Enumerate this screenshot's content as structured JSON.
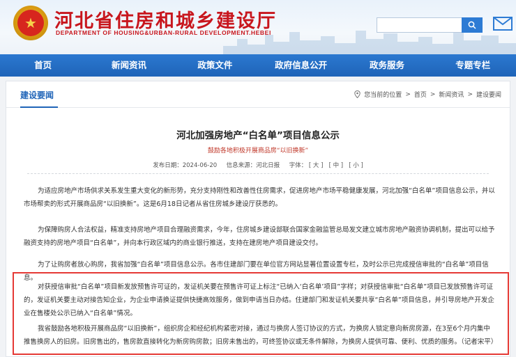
{
  "header": {
    "title": "河北省住房和城乡建设厅",
    "subtitle": "DEPARTMENT OF HOUSING&URBAN-RURAL DEVELOPMENT.HEBEI",
    "search_placeholder": ""
  },
  "nav": {
    "items": [
      "首页",
      "新闻资讯",
      "政策文件",
      "政府信息公开",
      "政务服务",
      "专题专栏"
    ]
  },
  "section": {
    "title": "建设要闻",
    "breadcrumb": {
      "prefix": "您当前的位置",
      "items": [
        "首页",
        "新闻资讯",
        "建设要闻"
      ],
      "separator": ">"
    }
  },
  "article": {
    "title": "河北加强房地产“白名单”项目信息公示",
    "subtitle": "鼓励各地积极开展商品房“以旧换新”",
    "meta": {
      "date_label": "发布日期：2024-06-20",
      "views_label": "信息来源：河北日报",
      "font_label": "字体：",
      "font_large": "[ 大 ]",
      "font_medium": "[ 中 ]",
      "font_small": "[ 小 ]"
    },
    "paragraphs": [
      "为适应房地产市场供求关系发生重大变化的新形势，充分支持刚性和改善性住房需求，促进房地产市场平稳健康发展，河北加强“白名单”项目信息公示，并以市场帮卖的形式开展商品房“以旧换新”。这是6月18日记者从省住房城乡建设厅获悉的。",
      "为保障购房人合法权益，精准支持房地产项目合理融资需求，今年，住房城乡建设部联合国家金融监管总局发文建立城市房地产融资协调机制，提出可以给予融资支持的房地产项目“白名单”，并向本行政区域内的商业银行推送，支持在建房地产项目建设交付。",
      "为了让购房者放心购房，我省加强“白名单”项目信息公示。各市住建部门要在单位官方网站显著位置设置专栏，及时公示已完成授信审批的“白名单”项目信息。",
      "对获授信审批“白名单”项目新发放预售许可证的，发证机关要在预售许可证上标注“已纳入‘白名单’项目”字样；对获授信审批“白名单”项目已发放预售许可证的，发证机关要主动对接告知企业，为企业申请换证提供快捷高效服务，做到申请当日办结。住建部门和发证机关要共享“白名单”项目信息，并引导房地产开发企业在售楼处公示已纳入“白名单”情况。",
      "我省鼓励各地积极开展商品房“以旧换新”，组织房企和经纪机构紧密对接，通过与换房人签订协议的方式，为换房人锁定意向新房房源，在3至6个月内集中推售换房人的旧房。旧房售出的，售房款直接转化为新房购房款；旧房未售出的，可终签协议或无条件解除，为换房人提供可靠、便利、优质的服务。（记者宋平）"
    ]
  },
  "colors": {
    "brand_red": "#c8161d",
    "nav_blue": "#1f64b8",
    "highlight_border": "#e53935"
  },
  "icons": [
    "emblem-icon",
    "search-icon",
    "mail-icon",
    "location-icon"
  ]
}
